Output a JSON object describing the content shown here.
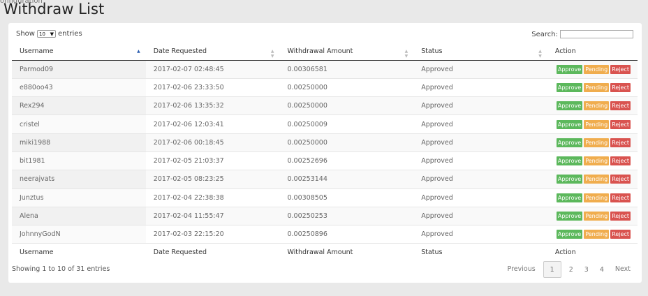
{
  "ghost_text": "onfiguration",
  "title": "Withdraw List",
  "controls": {
    "show_label": "Show",
    "entries_value": "10",
    "entries_label": "entries",
    "search_label": "Search:"
  },
  "columns": [
    "Username",
    "Date Requested",
    "Withdrawal Amount",
    "Status",
    "Action"
  ],
  "rows": [
    {
      "username": "Parmod09",
      "date": "2017-02-07 02:48:45",
      "amount": "0.00306581",
      "status": "Approved"
    },
    {
      "username": "e880oo43",
      "date": "2017-02-06 23:33:50",
      "amount": "0.00250000",
      "status": "Approved"
    },
    {
      "username": "Rex294",
      "date": "2017-02-06 13:35:32",
      "amount": "0.00250000",
      "status": "Approved"
    },
    {
      "username": "cristel",
      "date": "2017-02-06 12:03:41",
      "amount": "0.00250009",
      "status": "Approved"
    },
    {
      "username": "miki1988",
      "date": "2017-02-06 00:18:45",
      "amount": "0.00250000",
      "status": "Approved"
    },
    {
      "username": "bit1981",
      "date": "2017-02-05 21:03:37",
      "amount": "0.00252696",
      "status": "Approved"
    },
    {
      "username": "neerajvats",
      "date": "2017-02-05 08:23:25",
      "amount": "0.00253144",
      "status": "Approved"
    },
    {
      "username": "Junztus",
      "date": "2017-02-04 22:38:38",
      "amount": "0.00308505",
      "status": "Approved"
    },
    {
      "username": "Alena",
      "date": "2017-02-04 11:55:47",
      "amount": "0.00250253",
      "status": "Approved"
    },
    {
      "username": "JohnnyGodN",
      "date": "2017-02-03 22:15:20",
      "amount": "0.00250896",
      "status": "Approved"
    }
  ],
  "action_buttons": {
    "approve": "Approve",
    "pending": "Pending",
    "reject": "Reject"
  },
  "colors": {
    "approve": "#5cb85c",
    "pending": "#f0ad4e",
    "reject": "#d9534f"
  },
  "footer": {
    "info": "Showing 1 to 10 of 31 entries",
    "previous": "Previous",
    "pages": [
      "1",
      "2",
      "3",
      "4"
    ],
    "current_page": "1",
    "next": "Next"
  }
}
